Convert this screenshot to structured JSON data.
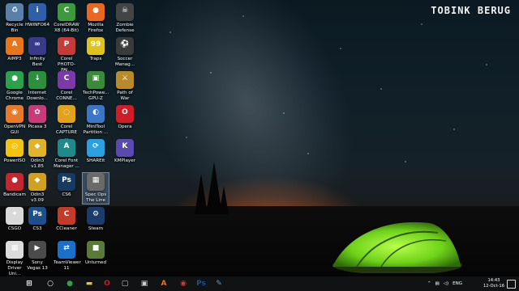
{
  "watermark": "TOBINK BERUG",
  "desktop_icons": [
    {
      "label": "Recycle Bin",
      "icon": "recycle-bin-icon",
      "color": "#5a7fa8",
      "glyph": "♻"
    },
    {
      "label": "AIMP3",
      "icon": "aimp-icon",
      "color": "#e8741c",
      "glyph": "A"
    },
    {
      "label": "Google Chrome",
      "icon": "chrome-icon",
      "color": "#2aa14a",
      "glyph": "●"
    },
    {
      "label": "OpenVPN GUI",
      "icon": "openvpn-icon",
      "color": "#e7792b",
      "glyph": "◉"
    },
    {
      "label": "PowerISO",
      "icon": "poweriso-icon",
      "color": "#f3c313",
      "glyph": "◎"
    },
    {
      "label": "Bandicam",
      "icon": "bandicam-icon",
      "color": "#c2262e",
      "glyph": "●"
    },
    {
      "label": "CSGO",
      "icon": "csgo-icon",
      "color": "#d9d9d9",
      "glyph": "✦"
    },
    {
      "label": "Display Driver Uni...",
      "icon": "ddu-icon",
      "color": "#dcdcdc",
      "glyph": "▦"
    },
    {
      "label": "HWiNFO64",
      "icon": "hwinfo-icon",
      "color": "#2f5fa8",
      "glyph": "i"
    },
    {
      "label": "Infinity Best",
      "icon": "infinity-icon",
      "color": "#3a3a8a",
      "glyph": "∞"
    },
    {
      "label": "Internet Downlo...",
      "icon": "idm-icon",
      "color": "#2c8f3c",
      "glyph": "↓"
    },
    {
      "label": "Picasa 3",
      "icon": "picasa-icon",
      "color": "#c83a7a",
      "glyph": "✿"
    },
    {
      "label": "Odin3 v1.85",
      "icon": "odin-icon",
      "color": "#e0b42a",
      "glyph": "◆"
    },
    {
      "label": "Odin3 v3.09",
      "icon": "odin-icon",
      "color": "#d0a020",
      "glyph": "◆"
    },
    {
      "label": "CS3",
      "icon": "photoshop-cs3-icon",
      "color": "#1d4f8a",
      "glyph": "Ps"
    },
    {
      "label": "Sony Vegas 13",
      "icon": "vegas-icon",
      "color": "#4b4b4b",
      "glyph": "▶"
    },
    {
      "label": "CorelDRAW X8 (64-Bit)",
      "icon": "coreldraw-icon",
      "color": "#3c9a3c",
      "glyph": "C"
    },
    {
      "label": "Corel PHOTO-PAI...",
      "icon": "corel-photopaint-icon",
      "color": "#c63a3a",
      "glyph": "P"
    },
    {
      "label": "Corel CONNE...",
      "icon": "corel-connect-icon",
      "color": "#7b3aa8",
      "glyph": "C"
    },
    {
      "label": "Corel CAPTURE ...",
      "icon": "corel-capture-icon",
      "color": "#e2a21e",
      "glyph": "◌"
    },
    {
      "label": "Corel Font Manager ...",
      "icon": "corel-font-icon",
      "color": "#1e8a8a",
      "glyph": "A"
    },
    {
      "label": "CS6",
      "icon": "photoshop-cs6-icon",
      "color": "#173a63",
      "glyph": "Ps"
    },
    {
      "label": "CCleaner",
      "icon": "ccleaner-icon",
      "color": "#c63a2a",
      "glyph": "C"
    },
    {
      "label": "TeamViewer 11",
      "icon": "teamviewer-icon",
      "color": "#1a6fc9",
      "glyph": "⇄"
    },
    {
      "label": "Mozilla Firefox",
      "icon": "firefox-icon",
      "color": "#e9671f",
      "glyph": "●"
    },
    {
      "label": "Traps",
      "icon": "traps-icon",
      "color": "#e0c21e",
      "glyph": "99"
    },
    {
      "label": "TechPowe... GPU-Z",
      "icon": "gpuz-icon",
      "color": "#3a8a3a",
      "glyph": "▣"
    },
    {
      "label": "MiniTool Partition ...",
      "icon": "minitool-icon",
      "color": "#3a78c6",
      "glyph": "◐"
    },
    {
      "label": "SHAREit",
      "icon": "shareit-icon",
      "color": "#2aa0e0",
      "glyph": "⟳"
    },
    {
      "label": "Spec Ops The Line",
      "icon": "specops-icon",
      "color": "#6a6a6a",
      "glyph": "▦"
    },
    {
      "label": "Steam",
      "icon": "steam-icon",
      "color": "#1b3b6a",
      "glyph": "⚙"
    },
    {
      "label": "Unturned",
      "icon": "unturned-icon",
      "color": "#5a7a3a",
      "glyph": "■"
    },
    {
      "label": "Zombie Defense",
      "icon": "zombie-defense-icon",
      "color": "#444",
      "glyph": "☠"
    },
    {
      "label": "Soccer Manag...",
      "icon": "soccer-manager-icon",
      "color": "#3a3a3a",
      "glyph": "⚽"
    },
    {
      "label": "Path of War",
      "icon": "path-of-war-icon",
      "color": "#b88a2a",
      "glyph": "⚔"
    },
    {
      "label": "Opera",
      "icon": "opera-icon",
      "color": "#d01c26",
      "glyph": "O"
    },
    {
      "label": "KMPlayer",
      "icon": "kmplayer-icon",
      "color": "#5a4ab0",
      "glyph": "K"
    }
  ],
  "taskbar": {
    "pinned": [
      {
        "icon": "start-icon",
        "color": "#ffffff",
        "glyph": "⊞"
      },
      {
        "icon": "search-icon",
        "color": "#ffffff",
        "glyph": "○"
      },
      {
        "icon": "task-view-icon",
        "color": "#ffffff",
        "glyph": "▭"
      },
      {
        "icon": "chrome-icon",
        "color": "#2aa14a",
        "glyph": "●"
      },
      {
        "icon": "file-explorer-icon",
        "color": "#e8c33a",
        "glyph": "▬"
      },
      {
        "icon": "opera-icon",
        "color": "#d01c26",
        "glyph": "O"
      },
      {
        "icon": "window-icon",
        "color": "#d0d0d0",
        "glyph": "▢"
      },
      {
        "icon": "media-icon",
        "color": "#cfcfcf",
        "glyph": "▣"
      },
      {
        "icon": "aimp-icon",
        "color": "#e8741c",
        "glyph": "A"
      },
      {
        "icon": "game-icon",
        "color": "#d83a2a",
        "glyph": "◉"
      },
      {
        "icon": "photoshop-icon",
        "color": "#1d4f8a",
        "glyph": "Ps"
      },
      {
        "icon": "utility-icon",
        "color": "#5a9ad0",
        "glyph": "✎"
      }
    ],
    "tray": {
      "language": "ENG",
      "time": "14:43",
      "date": "12-Oct-16"
    }
  }
}
